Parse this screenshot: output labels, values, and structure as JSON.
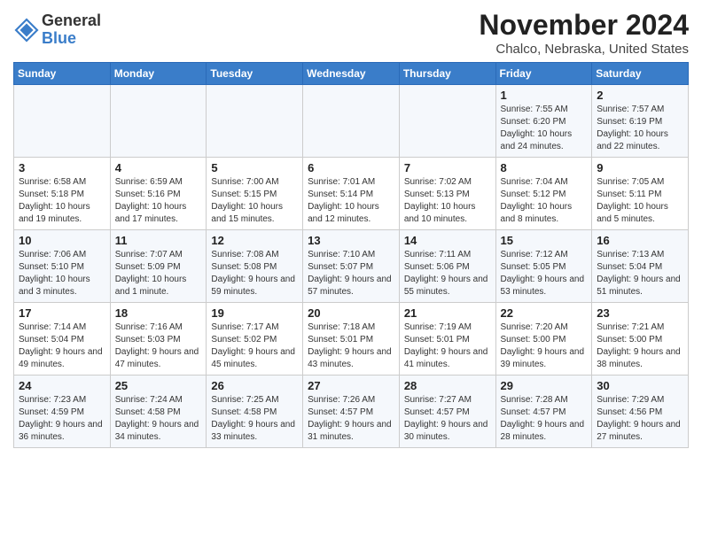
{
  "header": {
    "logo_line1": "General",
    "logo_line2": "Blue",
    "month_year": "November 2024",
    "location": "Chalco, Nebraska, United States"
  },
  "weekdays": [
    "Sunday",
    "Monday",
    "Tuesday",
    "Wednesday",
    "Thursday",
    "Friday",
    "Saturday"
  ],
  "weeks": [
    [
      {
        "day": "",
        "info": ""
      },
      {
        "day": "",
        "info": ""
      },
      {
        "day": "",
        "info": ""
      },
      {
        "day": "",
        "info": ""
      },
      {
        "day": "",
        "info": ""
      },
      {
        "day": "1",
        "info": "Sunrise: 7:55 AM\nSunset: 6:20 PM\nDaylight: 10 hours and 24 minutes."
      },
      {
        "day": "2",
        "info": "Sunrise: 7:57 AM\nSunset: 6:19 PM\nDaylight: 10 hours and 22 minutes."
      }
    ],
    [
      {
        "day": "3",
        "info": "Sunrise: 6:58 AM\nSunset: 5:18 PM\nDaylight: 10 hours and 19 minutes."
      },
      {
        "day": "4",
        "info": "Sunrise: 6:59 AM\nSunset: 5:16 PM\nDaylight: 10 hours and 17 minutes."
      },
      {
        "day": "5",
        "info": "Sunrise: 7:00 AM\nSunset: 5:15 PM\nDaylight: 10 hours and 15 minutes."
      },
      {
        "day": "6",
        "info": "Sunrise: 7:01 AM\nSunset: 5:14 PM\nDaylight: 10 hours and 12 minutes."
      },
      {
        "day": "7",
        "info": "Sunrise: 7:02 AM\nSunset: 5:13 PM\nDaylight: 10 hours and 10 minutes."
      },
      {
        "day": "8",
        "info": "Sunrise: 7:04 AM\nSunset: 5:12 PM\nDaylight: 10 hours and 8 minutes."
      },
      {
        "day": "9",
        "info": "Sunrise: 7:05 AM\nSunset: 5:11 PM\nDaylight: 10 hours and 5 minutes."
      }
    ],
    [
      {
        "day": "10",
        "info": "Sunrise: 7:06 AM\nSunset: 5:10 PM\nDaylight: 10 hours and 3 minutes."
      },
      {
        "day": "11",
        "info": "Sunrise: 7:07 AM\nSunset: 5:09 PM\nDaylight: 10 hours and 1 minute."
      },
      {
        "day": "12",
        "info": "Sunrise: 7:08 AM\nSunset: 5:08 PM\nDaylight: 9 hours and 59 minutes."
      },
      {
        "day": "13",
        "info": "Sunrise: 7:10 AM\nSunset: 5:07 PM\nDaylight: 9 hours and 57 minutes."
      },
      {
        "day": "14",
        "info": "Sunrise: 7:11 AM\nSunset: 5:06 PM\nDaylight: 9 hours and 55 minutes."
      },
      {
        "day": "15",
        "info": "Sunrise: 7:12 AM\nSunset: 5:05 PM\nDaylight: 9 hours and 53 minutes."
      },
      {
        "day": "16",
        "info": "Sunrise: 7:13 AM\nSunset: 5:04 PM\nDaylight: 9 hours and 51 minutes."
      }
    ],
    [
      {
        "day": "17",
        "info": "Sunrise: 7:14 AM\nSunset: 5:04 PM\nDaylight: 9 hours and 49 minutes."
      },
      {
        "day": "18",
        "info": "Sunrise: 7:16 AM\nSunset: 5:03 PM\nDaylight: 9 hours and 47 minutes."
      },
      {
        "day": "19",
        "info": "Sunrise: 7:17 AM\nSunset: 5:02 PM\nDaylight: 9 hours and 45 minutes."
      },
      {
        "day": "20",
        "info": "Sunrise: 7:18 AM\nSunset: 5:01 PM\nDaylight: 9 hours and 43 minutes."
      },
      {
        "day": "21",
        "info": "Sunrise: 7:19 AM\nSunset: 5:01 PM\nDaylight: 9 hours and 41 minutes."
      },
      {
        "day": "22",
        "info": "Sunrise: 7:20 AM\nSunset: 5:00 PM\nDaylight: 9 hours and 39 minutes."
      },
      {
        "day": "23",
        "info": "Sunrise: 7:21 AM\nSunset: 5:00 PM\nDaylight: 9 hours and 38 minutes."
      }
    ],
    [
      {
        "day": "24",
        "info": "Sunrise: 7:23 AM\nSunset: 4:59 PM\nDaylight: 9 hours and 36 minutes."
      },
      {
        "day": "25",
        "info": "Sunrise: 7:24 AM\nSunset: 4:58 PM\nDaylight: 9 hours and 34 minutes."
      },
      {
        "day": "26",
        "info": "Sunrise: 7:25 AM\nSunset: 4:58 PM\nDaylight: 9 hours and 33 minutes."
      },
      {
        "day": "27",
        "info": "Sunrise: 7:26 AM\nSunset: 4:57 PM\nDaylight: 9 hours and 31 minutes."
      },
      {
        "day": "28",
        "info": "Sunrise: 7:27 AM\nSunset: 4:57 PM\nDaylight: 9 hours and 30 minutes."
      },
      {
        "day": "29",
        "info": "Sunrise: 7:28 AM\nSunset: 4:57 PM\nDaylight: 9 hours and 28 minutes."
      },
      {
        "day": "30",
        "info": "Sunrise: 7:29 AM\nSunset: 4:56 PM\nDaylight: 9 hours and 27 minutes."
      }
    ]
  ]
}
